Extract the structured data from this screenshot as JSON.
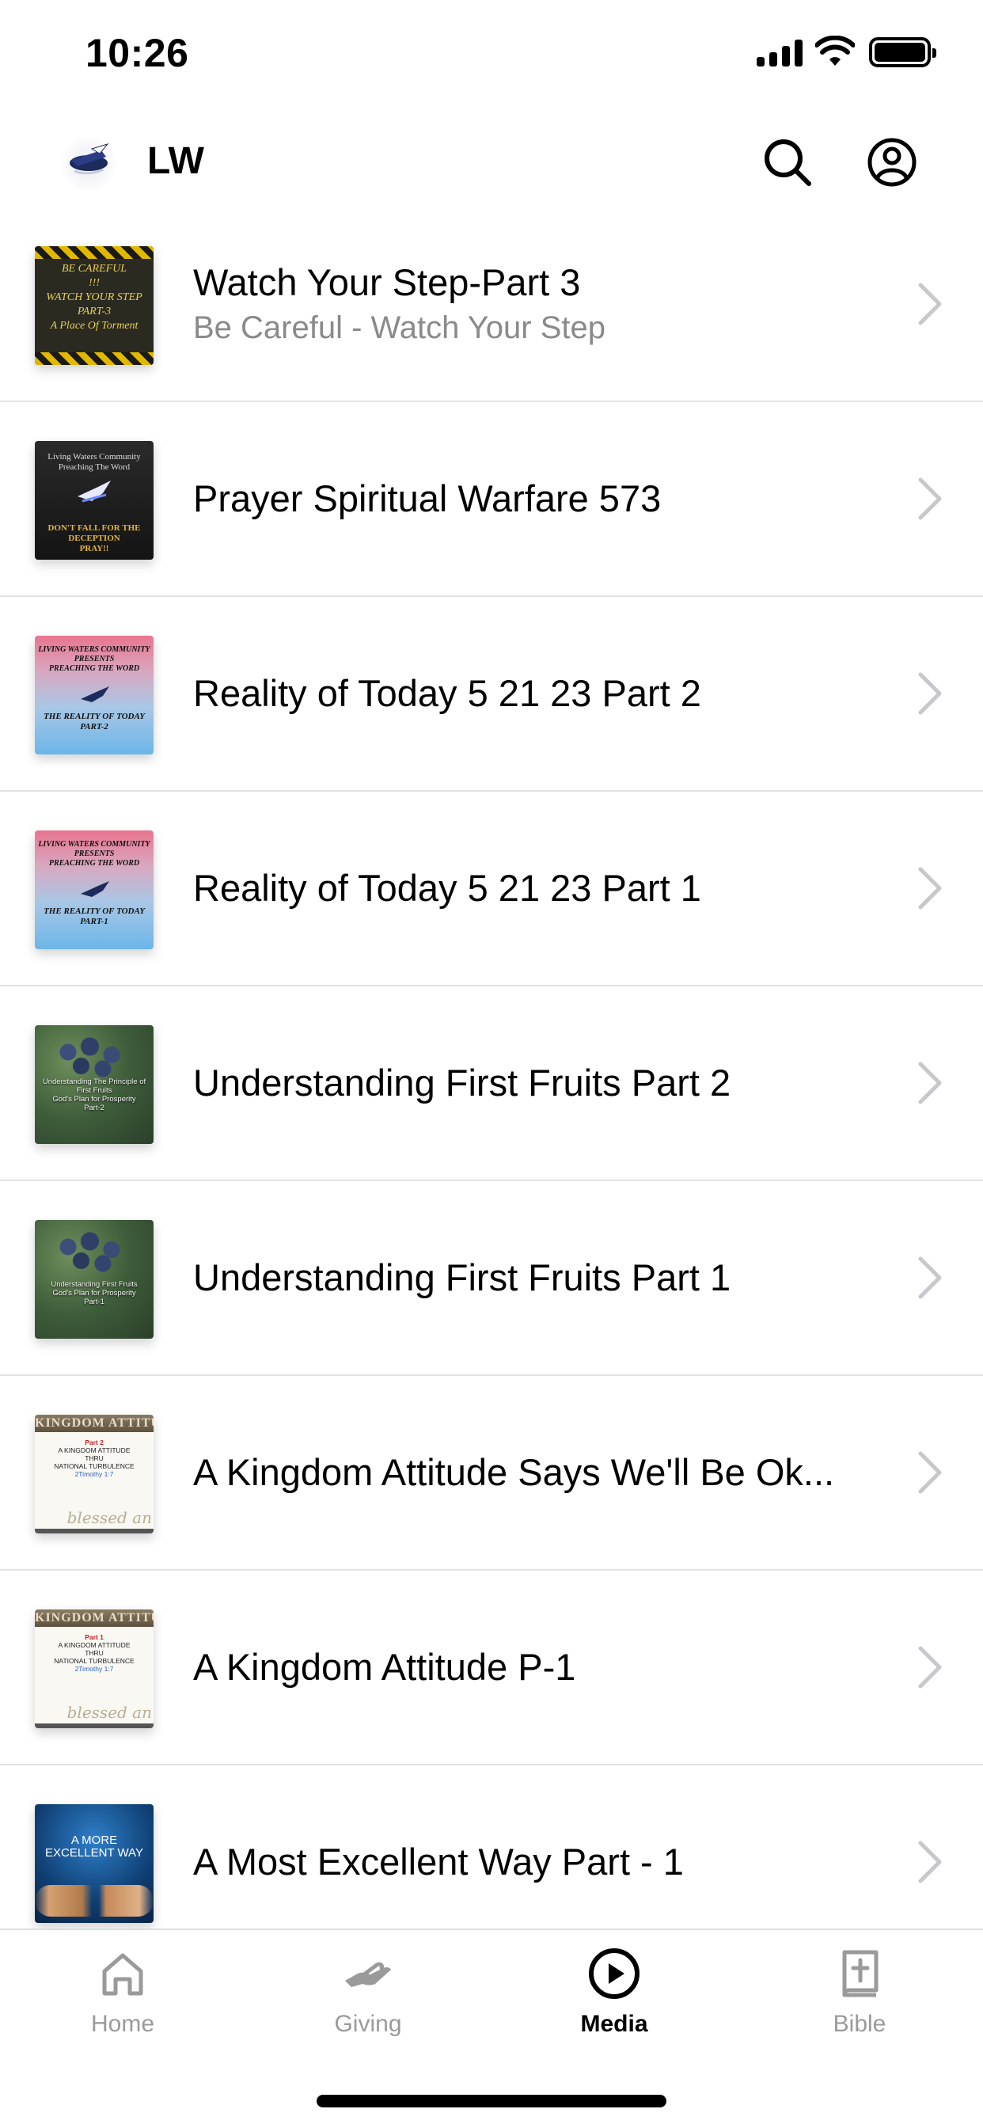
{
  "status_bar": {
    "time": "10:26"
  },
  "header": {
    "title": "LW"
  },
  "media_items": [
    {
      "title": "Watch Your Step-Part 3",
      "subtitle": "Be Careful - Watch Your Step"
    },
    {
      "title": "Prayer Spiritual Warfare 573",
      "subtitle": ""
    },
    {
      "title": "Reality of Today 5 21 23 Part 2",
      "subtitle": ""
    },
    {
      "title": "Reality of Today 5 21 23 Part 1",
      "subtitle": ""
    },
    {
      "title": "Understanding First Fruits Part 2",
      "subtitle": ""
    },
    {
      "title": "Understanding First Fruits Part 1",
      "subtitle": ""
    },
    {
      "title": "A Kingdom Attitude Says We'll Be Ok...",
      "subtitle": ""
    },
    {
      "title": "A Kingdom Attitude P-1",
      "subtitle": ""
    },
    {
      "title": "A Most Excellent Way Part - 1",
      "subtitle": ""
    }
  ],
  "thumb_text": {
    "t0": [
      "BE CAREFUL",
      "!!!",
      "WATCH YOUR STEP",
      "PART-3",
      "A Place Of Torment"
    ],
    "t1a": [
      "Living Waters Community",
      "Preaching The Word"
    ],
    "t1b": [
      "DON'T FALL FOR THE",
      "DECEPTION",
      "PRAY!!"
    ],
    "t2": [
      "LIVING WATERS COMMUNITY",
      "PRESENTS",
      "PREACHING THE WORD"
    ],
    "t2b": [
      "THE REALITY OF TODAY",
      "PART-2"
    ],
    "t3b": [
      "THE REALITY OF TODAY",
      "PART-1"
    ],
    "t4": [
      "Understanding The Principle of",
      "First Fruits",
      "God's Plan for Prosperity",
      "Part-2"
    ],
    "t5": [
      "Understanding First Fruits",
      "God's Plan for Prosperity",
      "Part-1"
    ],
    "t6": {
      "band": "KINGDOM ATTITUDE",
      "part": "Part 2",
      "lines": [
        "A KINGDOM ATTITUDE",
        "THRU",
        "NATIONAL TURBULENCE"
      ],
      "ref": "2Timothy 1:7",
      "swirl": "blessed an"
    },
    "t7": {
      "band": "KINGDOM ATTITUDE",
      "part": "Part 1",
      "lines": [
        "A KINGDOM ATTITUDE",
        "THRU",
        "NATIONAL TURBULENCE"
      ],
      "ref": "2Timothy 1:7",
      "swirl": "blessed an"
    },
    "t8": [
      "A MORE",
      "EXCELLENT WAY"
    ]
  },
  "tabs": [
    {
      "label": "Home",
      "icon": "home-icon",
      "active": false
    },
    {
      "label": "Giving",
      "icon": "giving-hand-icon",
      "active": false
    },
    {
      "label": "Media",
      "icon": "play-circle-icon",
      "active": true
    },
    {
      "label": "Bible",
      "icon": "bible-book-icon",
      "active": false
    }
  ],
  "colors": {
    "active_tab": "#000000",
    "inactive_tab": "#9a9a9a",
    "divider": "#e2e2e2",
    "subtitle": "#8a8a8a"
  }
}
